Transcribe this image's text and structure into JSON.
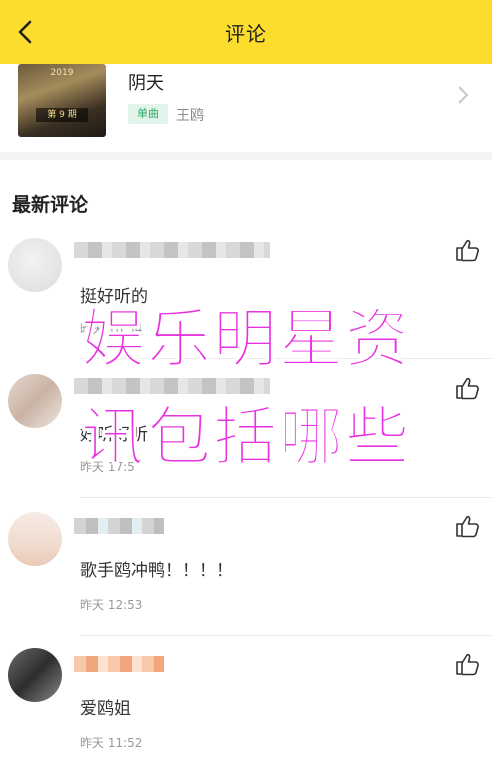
{
  "header": {
    "title": "评论"
  },
  "song": {
    "title": "阴天",
    "tag": "单曲",
    "artist": "王鸥",
    "cover_year": "2019",
    "cover_episode": "第 9 期"
  },
  "section": {
    "title": "最新评论"
  },
  "comments": [
    {
      "text": "挺好听的",
      "time": "昨天 18:54"
    },
    {
      "text": "好听好听",
      "time": "昨天 17:5"
    },
    {
      "text": "歌手鸥冲鸭！！！！",
      "time": "昨天 12:53"
    },
    {
      "text": "爱鸥姐",
      "time": "昨天 11:52"
    }
  ],
  "overlay": {
    "line1": "娱乐明星资",
    "line2": "讯包括哪些"
  },
  "colors": {
    "header_bg": "#fcdc2c",
    "overlay_text": "#e933e0",
    "tag_text": "#2fa765"
  }
}
